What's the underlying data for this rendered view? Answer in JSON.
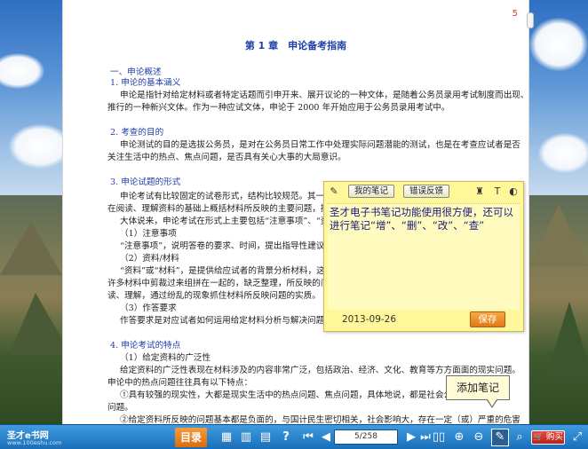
{
  "page": {
    "page_number": "5",
    "chapter_title": "第 1 章　申论备考指南",
    "lines": [
      {
        "text": "一、申论概述",
        "style": "blue"
      },
      {
        "text": "1. 申论的基本涵义",
        "style": "blue"
      },
      {
        "text": "申论是指针对给定材料或者特定话题而引申开来、展开议论的一种文体，是随着公务员录用考试制度而出现、",
        "style": "body"
      },
      {
        "text": "推行的一种新兴文体。作为一种应试文体，申论于 2000 年开始应用于公务员录用考试中。",
        "style": "body"
      },
      {
        "text": "2. 考查的目的",
        "style": "blue"
      },
      {
        "text": "申论测试的目的是选拔公务员，是对在公务员日常工作中处理实际问题潜能的测试，也是在考查应试者是否",
        "style": "body"
      },
      {
        "text": "关注生活中的热点、焦点问题，是否具有关心大事的大局意识。",
        "style": "body"
      },
      {
        "text": "3. 申论试题的形式",
        "style": "blue"
      },
      {
        "text": "申论考试有比较固定的试卷形式，结构比较规范。其一般形",
        "style": "body"
      },
      {
        "text": "在阅读、理解资料的基础上概括材料所反映的主要问题，提出解",
        "style": "body"
      },
      {
        "text": "大体说来，申论考试在形式上主要包括“注意事项”、“资料",
        "style": "body"
      },
      {
        "text": "（1）注意事项",
        "style": "body"
      },
      {
        "text": "“注意事项”，说明答卷的要求、时间，提出指导性建议；",
        "style": "body"
      },
      {
        "text": "（2）资料/材料",
        "style": "body"
      },
      {
        "text": "“资料”或“材料”，是提供给应试者的背景分析材料，这",
        "style": "body"
      },
      {
        "text": "许多材料中剪裁过来组拼在一起的，缺乏整理，所反映的问题也",
        "style": "body"
      },
      {
        "text": "读、理解，通过纷乱的现象抓住材料所反映问题的实质。",
        "style": "body"
      },
      {
        "text": "（3）作答要求",
        "style": "body"
      },
      {
        "text": "作答要求是对应试者如何运用给定材料分析与解决问题明确",
        "style": "body"
      },
      {
        "text": "4. 申论考试的特点",
        "style": "blue"
      },
      {
        "text": "（1）给定资料的广泛性",
        "style": "body"
      },
      {
        "text": "给定资料的广泛性表现在材料涉及的内容非常广泛，包括政治、经济、文化、教育等方方面面的现实问题。",
        "style": "body"
      },
      {
        "text": "申论中的热点问题往往具有以下特点：",
        "style": "body"
      },
      {
        "text": "①具有较强的现实性，大都是现实生活中的热点问题、焦点问题，具体地说，都是社会公共事",
        "style": "body"
      },
      {
        "text": "问题。",
        "style": "body"
      },
      {
        "text": "②给定资料所反映的问题基本都是负面的，与国计民生密切相关，社会影响大，存在一定（或）严重的危害",
        "style": "body"
      }
    ]
  },
  "note": {
    "my_notes_label": "我的笔记",
    "feedback_label": "错误反馈",
    "content": "圣才电子书笔记功能使用很方便，还可以进行笔记“增”、“删”、“改”、“查”",
    "date": "2013-09-26",
    "save_label": "保存",
    "icons": [
      "pencil-icon",
      "paint-bucket-icon",
      "text-icon",
      "help-icon"
    ]
  },
  "tooltip": {
    "text": "添加笔记"
  },
  "toolbar": {
    "brand": "圣才e书网",
    "brand_url": "www.100eshu.com",
    "toc_label": "目录",
    "page_indicator": "5/258",
    "buy_label": "购买",
    "accent": "#e07815",
    "bar_color": "#1a6fb8"
  }
}
